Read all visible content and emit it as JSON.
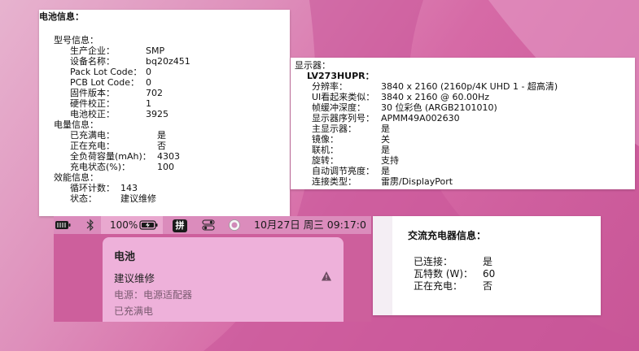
{
  "battery_panel": {
    "title": "电池信息：",
    "model_header": "型号信息：",
    "model": [
      {
        "label": "生产企业：",
        "value": "SMP"
      },
      {
        "label": "设备名称：",
        "value": "bq20z451"
      },
      {
        "label": "Pack Lot Code：",
        "value": "0"
      },
      {
        "label": "PCB Lot Code：",
        "value": "0"
      },
      {
        "label": "固件版本：",
        "value": "702"
      },
      {
        "label": "硬件校正：",
        "value": "1"
      },
      {
        "label": "电池校正：",
        "value": "3925"
      }
    ],
    "charge_header": "电量信息：",
    "charge": [
      {
        "label": "已充满电：",
        "value": "是"
      },
      {
        "label": "正在充电：",
        "value": "否"
      },
      {
        "label": "全负荷容量(mAh)：",
        "value": "4303"
      },
      {
        "label": "充电状态(%)：",
        "value": "100"
      }
    ],
    "health_header": "效能信息：",
    "health": [
      {
        "label": "循环计数：",
        "value": "143"
      },
      {
        "label": "状态：",
        "value": "建议维修"
      }
    ]
  },
  "display_panel": {
    "title": "显示器：",
    "name": "LV273HUPR：",
    "rows": [
      {
        "label": "分辨率：",
        "value": "3840 x 2160 (2160p/4K UHD 1 - 超高清)"
      },
      {
        "label": "UI看起来类似：",
        "value": "3840 x 2160 @ 60.00Hz"
      },
      {
        "label": "帧缓冲深度：",
        "value": "30 位彩色 (ARGB2101010)"
      },
      {
        "label": "显示器序列号：",
        "value": "APMM49A002630"
      },
      {
        "label": "主显示器：",
        "value": "是"
      },
      {
        "label": "镜像：",
        "value": "关"
      },
      {
        "label": "联机：",
        "value": "是"
      },
      {
        "label": "旋转：",
        "value": "支持"
      },
      {
        "label": "自动调节亮度：",
        "value": "是"
      },
      {
        "label": "连接类型：",
        "value": "雷雳/DisplayPort"
      }
    ]
  },
  "menubar": {
    "battery_percent": "100%",
    "input_method": "拼",
    "datetime": "10月27日 周三  09:17:0"
  },
  "battery_popup": {
    "title": "电池",
    "condition": "建议维修",
    "power_source": "电源：电源适配器",
    "status": "已充满电"
  },
  "ac_panel": {
    "title": "交流充电器信息：",
    "rows": [
      {
        "label": "已连接：",
        "value": "是"
      },
      {
        "label": "瓦特数 (W)：",
        "value": "60"
      },
      {
        "label": "正在充电：",
        "value": "否"
      }
    ]
  }
}
